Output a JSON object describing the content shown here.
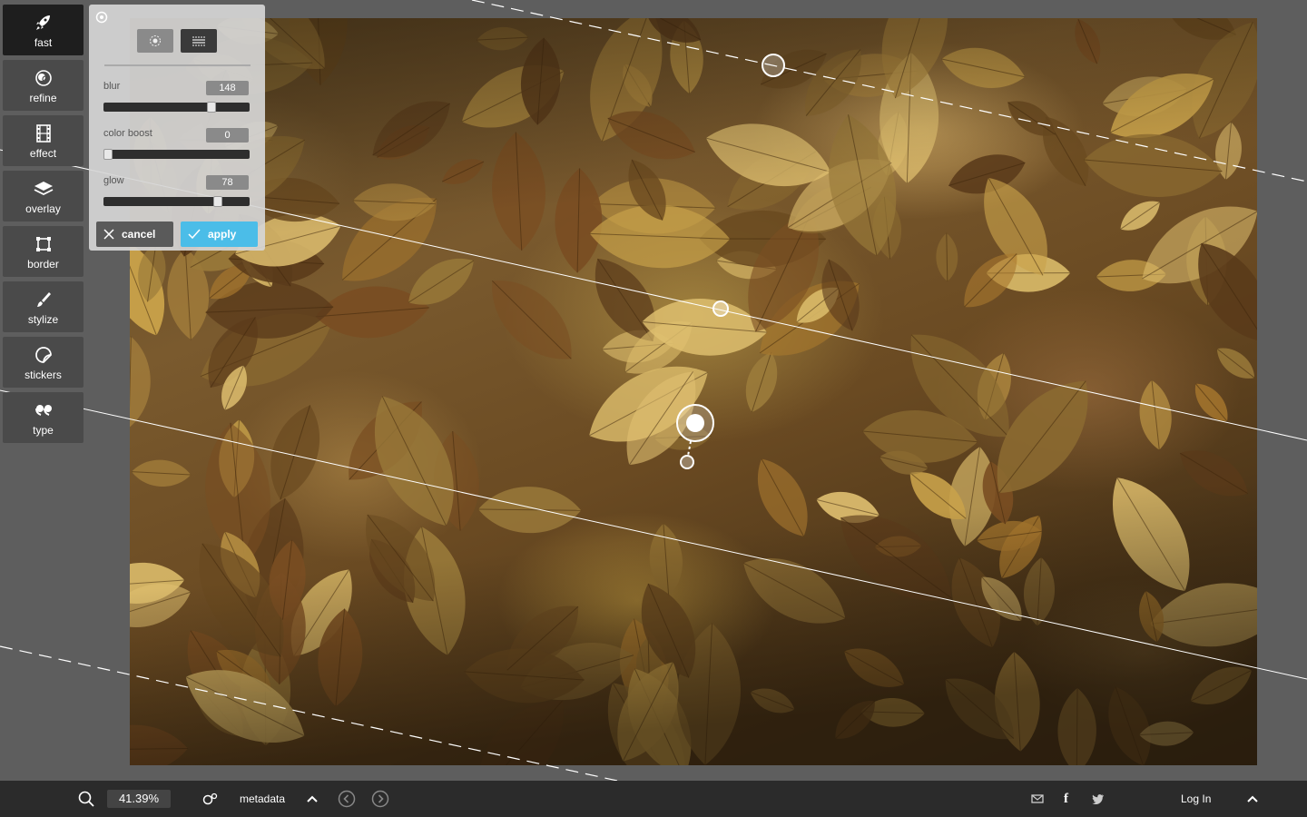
{
  "toolbar": {
    "items": [
      {
        "label": "fast",
        "icon": "rocket-icon",
        "active": true
      },
      {
        "label": "refine",
        "icon": "refine-icon",
        "active": false
      },
      {
        "label": "effect",
        "icon": "film-icon",
        "active": false
      },
      {
        "label": "overlay",
        "icon": "layers-icon",
        "active": false
      },
      {
        "label": "border",
        "icon": "border-icon",
        "active": false
      },
      {
        "label": "stylize",
        "icon": "brush-icon",
        "active": false
      },
      {
        "label": "stickers",
        "icon": "sticker-icon",
        "active": false
      },
      {
        "label": "type",
        "icon": "quote-icon",
        "active": false
      }
    ]
  },
  "panel": {
    "params": [
      {
        "label": "blur",
        "value": "148",
        "level": 0.74
      },
      {
        "label": "color boost",
        "value": "0",
        "level": 0.0
      },
      {
        "label": "glow",
        "value": "78",
        "level": 0.78
      }
    ],
    "cancel_label": "cancel",
    "apply_label": "apply",
    "accent": "#4bbde8"
  },
  "bottombar": {
    "zoom": "41.39%",
    "metadata_label": "metadata",
    "login_label": "Log In"
  }
}
